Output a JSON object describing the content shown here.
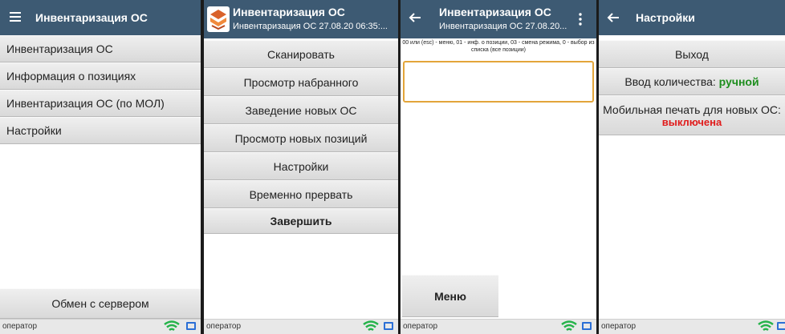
{
  "screen1": {
    "title": "Инвентаризация ОС",
    "menu": [
      "Инвентаризация ОС",
      "Информация о позициях",
      "Инвентаризация ОС (по МОЛ)",
      "Настройки"
    ],
    "exchange_label": "Обмен с сервером",
    "operator": "оператор"
  },
  "screen2": {
    "title": "Инвентаризация ОС",
    "subtitle": "Инвентаризация ОС 27.08.20 06:35:...",
    "buttons": [
      "Сканировать",
      "Просмотр набранного",
      "Заведение новых ОС",
      "Просмотр новых позиций",
      "Настройки",
      "Временно прервать",
      "Завершить"
    ],
    "operator": "оператор"
  },
  "screen3": {
    "title": "Инвентаризация ОС",
    "subtitle": "Инвентаризация ОС 27.08.20...",
    "hint": "00 или (esc) - меню, 01 - инф. о позиции, 03 - смена режима, 0 - выбор из списка (все позиции)",
    "input_value": "",
    "menu_label": "Меню",
    "operator": "оператор"
  },
  "screen4": {
    "title": "Настройки",
    "exit_label": "Выход",
    "qty_label": "Ввод количества:",
    "qty_value": "ручной",
    "print_label": "Мобильная печать для новых ОС:",
    "print_value": "выключена",
    "operator": "оператор"
  },
  "colors": {
    "header": "#3d5a73",
    "green_value": "#1e8e1e",
    "red_value": "#e01b1b",
    "wifi": "#25b34a",
    "monitor": "#2b6fd6"
  }
}
